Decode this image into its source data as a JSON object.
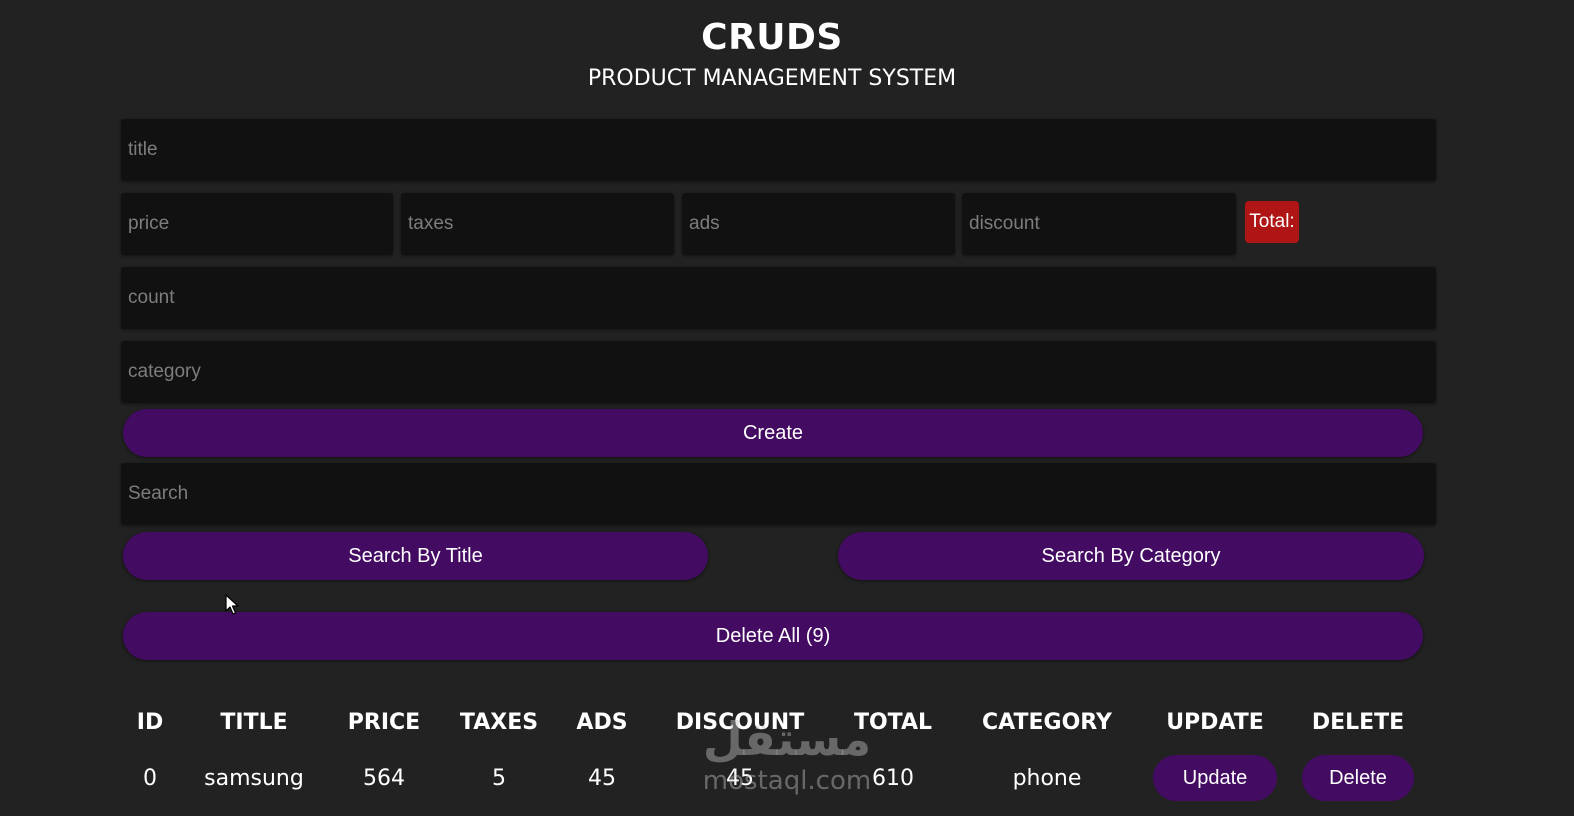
{
  "header": {
    "title": "CRUDS",
    "subtitle": "PRODUCT MANAGEMENT SYSTEM"
  },
  "form": {
    "title_placeholder": "title",
    "price_placeholder": "price",
    "taxes_placeholder": "taxes",
    "ads_placeholder": "ads",
    "discount_placeholder": "discount",
    "total_label": "Total:",
    "count_placeholder": "count",
    "category_placeholder": "category",
    "create_label": "Create"
  },
  "search": {
    "placeholder": "Search",
    "by_title_label": "Search By Title",
    "by_category_label": "Search By Category"
  },
  "delete_all_label": "Delete All (9)",
  "table": {
    "headers": [
      "ID",
      "TITLE",
      "PRICE",
      "TAXES",
      "ADS",
      "DISCOUNT",
      "TOTAL",
      "CATEGORY",
      "UPDATE",
      "DELETE"
    ],
    "rows": [
      {
        "id": "0",
        "title": "samsung",
        "price": "564",
        "taxes": "5",
        "ads": "45",
        "discount": "45",
        "total": "610",
        "category": "phone",
        "update_label": "Update",
        "delete_label": "Delete"
      }
    ]
  },
  "watermark": {
    "arabic": "مستقل",
    "latin": "mostaql.com"
  },
  "colors": {
    "background": "#222222",
    "input_bg": "#111111",
    "button": "#430b61",
    "total_badge": "#b01515"
  }
}
